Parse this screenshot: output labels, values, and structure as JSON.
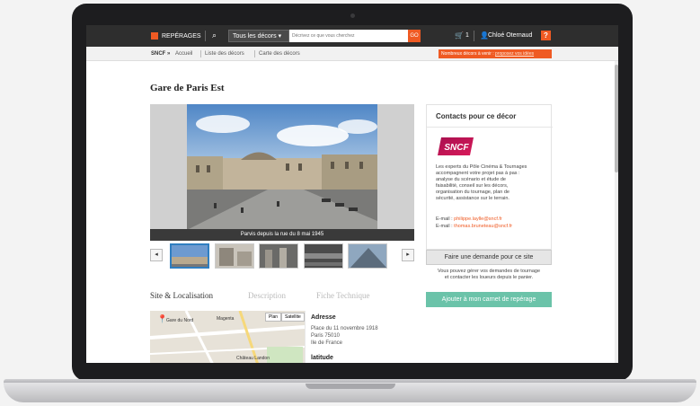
{
  "header": {
    "brand": "REPÉRAGES",
    "decor_select": "Tous les décors",
    "search_placeholder": "Décrivez ce que vous cherchez",
    "search_go": "GO",
    "cart_count": "1",
    "user_name": "Chloé Oternaud",
    "help": "?"
  },
  "breadcrumb": {
    "root": "SNCF »",
    "items": [
      "Accueil",
      "Liste des décors",
      "Carte des décors"
    ],
    "promo_text": "Nombreux décors à venir :",
    "promo_link": "proposez vos idées"
  },
  "page": {
    "title": "Gare de Paris Est",
    "photo_caption": "Parvis depuis la rue du 8 mai 1945",
    "prev": "◂",
    "next": "▸",
    "tabs": [
      "Site & Localisation",
      "Description",
      "Fiche Technique"
    ]
  },
  "map": {
    "controls": [
      "Plan",
      "Satellite"
    ],
    "labels": [
      "Gare du Nord",
      "Magenta",
      "Château Landon"
    ]
  },
  "address": {
    "heading": "Adresse",
    "line1": "Place du 11 novembre 1918",
    "line2": "Paris 75010",
    "line3": "Ile de France",
    "lat_heading": "latitude"
  },
  "contact": {
    "heading": "Contacts pour ce décor",
    "logo_text": "SNCF",
    "description_lines": [
      "Les experts du Pôle Cinéma & Tournages",
      "accompagnent votre projet pas à pas :",
      "analyse du scénario et étude de",
      "faisabilité, conseil sur les décors,",
      "organisation du tournage, plan de",
      "sécurité, assistance sur le terrain."
    ],
    "email_label": "E-mail :",
    "email1": "philippe.laylle@sncf.fr",
    "email2": "thomas.bruneteau@sncf.fr"
  },
  "actions": {
    "demande": "Faire une demande pour ce site",
    "demande_note1": "Vous pouvez gérer vos demandes de tournage",
    "demande_note2": "et contacter les loueurs depuis le panier.",
    "carnet": "Ajouter à mon carnet de repérage"
  },
  "colors": {
    "accent": "#ef5a23",
    "green": "#6bc3a9",
    "topbar": "#2e2e2e"
  }
}
